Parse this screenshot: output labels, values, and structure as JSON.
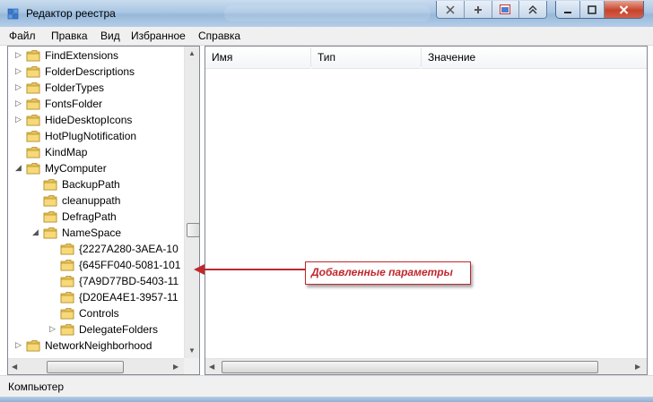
{
  "window": {
    "title": "Редактор реестра"
  },
  "menu": [
    "Файл",
    "Правка",
    "Вид",
    "Избранное",
    "Справка"
  ],
  "tree": {
    "items": [
      {
        "label": "FindExtensions",
        "level": 1,
        "expander": "collapsed"
      },
      {
        "label": "FolderDescriptions",
        "level": 1,
        "expander": "collapsed"
      },
      {
        "label": "FolderTypes",
        "level": 1,
        "expander": "collapsed"
      },
      {
        "label": "FontsFolder",
        "level": 1,
        "expander": "collapsed"
      },
      {
        "label": "HideDesktopIcons",
        "level": 1,
        "expander": "collapsed"
      },
      {
        "label": "HotPlugNotification",
        "level": 1,
        "expander": "none"
      },
      {
        "label": "KindMap",
        "level": 1,
        "expander": "none"
      },
      {
        "label": "MyComputer",
        "level": 1,
        "expander": "expanded"
      },
      {
        "label": "BackupPath",
        "level": 2,
        "expander": "none"
      },
      {
        "label": "cleanuppath",
        "level": 2,
        "expander": "none"
      },
      {
        "label": "DefragPath",
        "level": 2,
        "expander": "none"
      },
      {
        "label": "NameSpace",
        "level": 2,
        "expander": "expanded"
      },
      {
        "label": "{2227A280-3AEA-10",
        "level": 3,
        "expander": "none"
      },
      {
        "label": "{645FF040-5081-101",
        "level": 3,
        "expander": "none"
      },
      {
        "label": "{7A9D77BD-5403-11",
        "level": 3,
        "expander": "none"
      },
      {
        "label": "{D20EA4E1-3957-11",
        "level": 3,
        "expander": "none"
      },
      {
        "label": "Controls",
        "level": 3,
        "expander": "none"
      },
      {
        "label": "DelegateFolders",
        "level": 3,
        "expander": "collapsed"
      },
      {
        "label": "NetworkNeighborhood",
        "level": 1,
        "expander": "collapsed"
      }
    ]
  },
  "list": {
    "columns": [
      "Имя",
      "Тип",
      "Значение"
    ]
  },
  "status": {
    "text": "Компьютер"
  },
  "annotation": {
    "text": "Добавленные параметры",
    "color": "#c0272d"
  },
  "icons": {
    "folder": "folder-icon",
    "app": "registry-editor-icon"
  }
}
